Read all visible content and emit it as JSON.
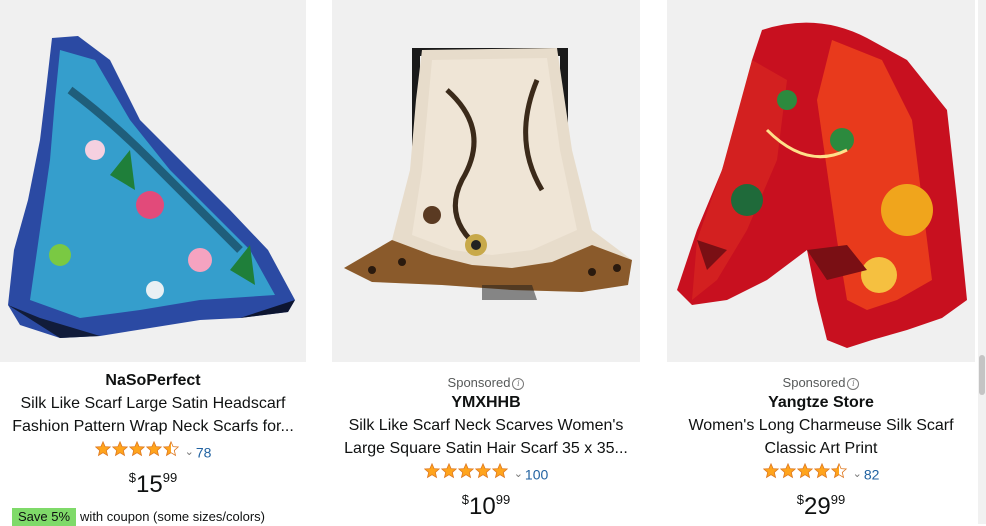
{
  "products": [
    {
      "sponsored": "",
      "brand": "NaSoPerfect",
      "title_line1": "Silk Like Scarf Large Satin Headscarf",
      "title_line2": "Fashion Pattern Wrap Neck Scarfs for...",
      "rating": 4.5,
      "review_count": "78",
      "price_symbol": "$",
      "price_whole": "15",
      "price_fraction": "99",
      "coupon_badge": "Save 5%",
      "coupon_text": "with coupon (some sizes/colors)"
    },
    {
      "sponsored": "Sponsored",
      "brand": "YMXHHB",
      "title_line1": "Silk Like Scarf Neck Scarves Women's",
      "title_line2": "Large Square Satin Hair Scarf 35 x 35...",
      "rating": 5,
      "review_count": "100",
      "price_symbol": "$",
      "price_whole": "10",
      "price_fraction": "99"
    },
    {
      "sponsored": "Sponsored",
      "brand": "Yangtze Store",
      "title_line1": "Women's Long Charmeuse Silk Scarf",
      "title_line2": "Classic Art Print",
      "rating": 4.5,
      "review_count": "82",
      "price_symbol": "$",
      "price_whole": "29",
      "price_fraction": "99"
    }
  ],
  "icons": {
    "star": "star-icon",
    "chevron": "chevron-down-icon",
    "info": "info-icon"
  },
  "colors": {
    "star": "#ffa41c",
    "link": "#2162a1",
    "coupon": "#7fda69",
    "image_bg": "#f0f0f0"
  }
}
